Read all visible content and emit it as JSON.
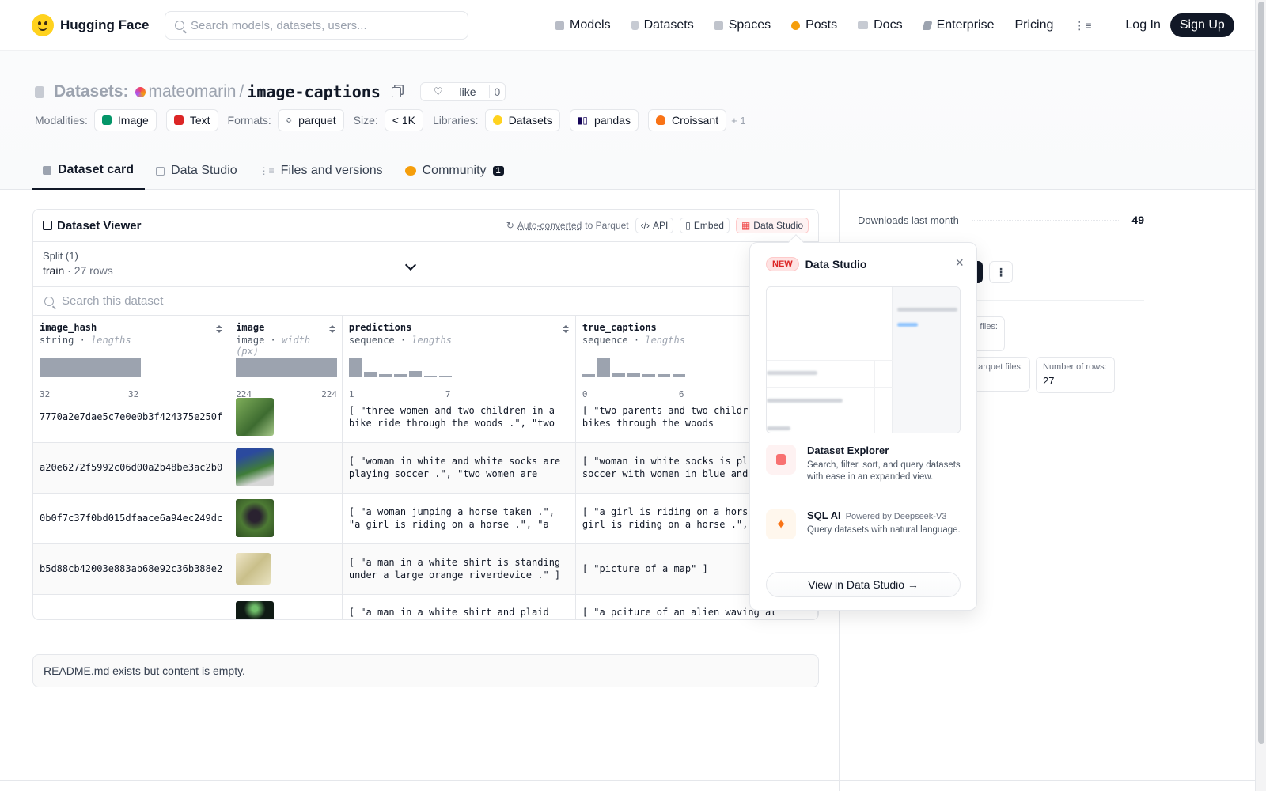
{
  "nav": {
    "brand": "Hugging Face",
    "search_placeholder": "Search models, datasets, users...",
    "links": [
      "Models",
      "Datasets",
      "Spaces",
      "Posts",
      "Docs",
      "Enterprise",
      "Pricing"
    ],
    "login": "Log In",
    "signup": "Sign Up"
  },
  "header": {
    "section": "Datasets:",
    "user": "mateomarin",
    "slash": "/",
    "repo": "image-captions",
    "like_label": "like",
    "like_count": "0",
    "modalities_label": "Modalities:",
    "modalities": [
      "Image",
      "Text"
    ],
    "formats_label": "Formats:",
    "format": "parquet",
    "size_label": "Size:",
    "size": "< 1K",
    "libraries_label": "Libraries:",
    "libraries": [
      "Datasets",
      "pandas",
      "Croissant"
    ],
    "libraries_more": "+ 1"
  },
  "tabs": {
    "card": "Dataset card",
    "studio": "Data Studio",
    "files": "Files and versions",
    "community": "Community",
    "community_count": "1"
  },
  "viewer": {
    "title": "Dataset Viewer",
    "auto_converted": "Auto-converted",
    "to_parquet": "to Parquet",
    "api": "API",
    "embed": "Embed",
    "studio": "Data Studio",
    "split_label": "Split (1)",
    "split_value": "train",
    "split_rows": "27 rows",
    "search_placeholder": "Search this dataset",
    "columns": [
      {
        "name": "image_hash",
        "type": "string",
        "stat": "lengths",
        "min": "32",
        "max": "32"
      },
      {
        "name": "image",
        "type": "image",
        "stat": "width (px)",
        "min": "224",
        "max": "224"
      },
      {
        "name": "predictions",
        "type": "sequence",
        "stat": "lengths",
        "min": "1",
        "max": "7"
      },
      {
        "name": "true_captions",
        "type": "sequence",
        "stat": "lengths",
        "min": "0",
        "max": "6"
      }
    ],
    "rows": [
      {
        "hash": "7770a2e7dae5c7e0e0b3f424375e250f",
        "pred": "[ \"three women and two children in a bike ride through the woods .\", \"two parents…",
        "true": "[ \"two parents and two children riding bikes through the woods",
        "thumb": "#4f7a3a"
      },
      {
        "hash": "a20e6272f5992c06d00a2b48be3ac2b0",
        "pred": "[ \"woman in white and white socks are playing soccer .\", \"two women are playin…",
        "true": "[ \"woman in white socks is playing soccer with women in blue and",
        "thumb": "#2e5a2a"
      },
      {
        "hash": "0b0f7c37f0bd015dfaace6a94ec249dc",
        "pred": "[ \"a woman jumping a horse taken .\", \"a girl is riding on a horse .\", \"a girl is…",
        "true": "[ \"a girl is riding on a horse .\", \"a girl is riding on a horse .\",",
        "thumb": "#3e5b2c"
      },
      {
        "hash": "b5d88cb42003e883ab68e92c36b388e2",
        "pred": "[ \"a man in a white shirt is standing under a large orange riverdevice .\" ]",
        "true": "[ \"picture of a map\" ]",
        "thumb": "#d9cfa6"
      },
      {
        "hash": "",
        "pred": "[ \"a man in a white shirt and plaid shirt",
        "true": "[ \"a pciture of an alien waving at",
        "thumb": "#0f1a14"
      }
    ]
  },
  "readme": "README.md exists but content is empty.",
  "right": {
    "downloads_label": "Downloads last month",
    "downloads_value": "49",
    "files_label": "files:",
    "parquet_label": "arquet files:",
    "rows_label": "Number of rows:",
    "rows_value": "27"
  },
  "popover": {
    "badge": "NEW",
    "title": "Data Studio",
    "close": "×",
    "explorer_title": "Dataset Explorer",
    "explorer_desc": "Search, filter, sort, and query datasets with ease in an expanded view.",
    "sql_title": "SQL AI",
    "sql_powered": "Powered by Deepseek-V3",
    "sql_desc": "Query datasets with natural language.",
    "button": "View in Data Studio →"
  }
}
